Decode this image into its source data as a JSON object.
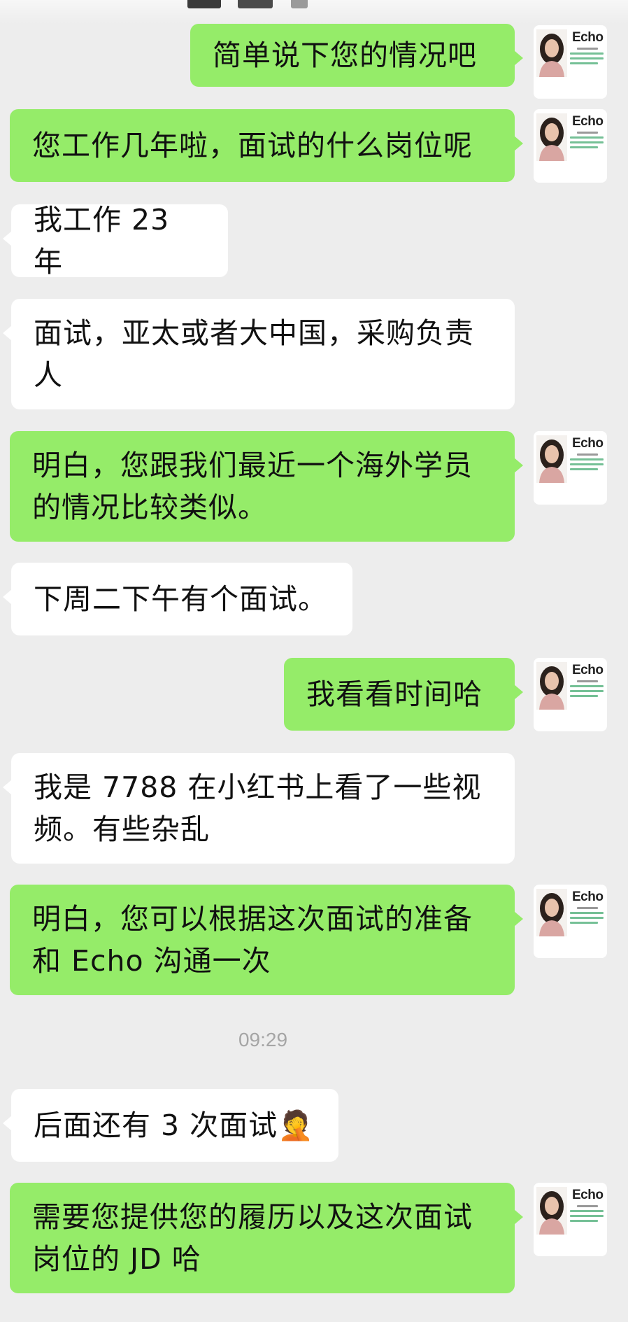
{
  "colors": {
    "background": "#ededed",
    "outgoing_bubble": "#95ec69",
    "incoming_bubble": "#ffffff",
    "timestamp_text": "#a5a5a5"
  },
  "avatar": {
    "brand_text": "Echo",
    "icon": "person-photo-with-echo-logo"
  },
  "messages": [
    {
      "direction": "outgoing",
      "text": "简单说下您的情况吧"
    },
    {
      "direction": "outgoing",
      "text": "您工作几年啦，面试的什么岗位呢"
    },
    {
      "direction": "incoming",
      "text": "我工作 23 年"
    },
    {
      "direction": "incoming",
      "text": "面试，亚太或者大中国，采购负责人"
    },
    {
      "direction": "outgoing",
      "text": "明白，您跟我们最近一个海外学员的情况比较类似。"
    },
    {
      "direction": "incoming",
      "text": "下周二下午有个面试。"
    },
    {
      "direction": "outgoing",
      "text": "我看看时间哈"
    },
    {
      "direction": "incoming",
      "text": "我是 7788 在小红书上看了一些视频。有些杂乱"
    },
    {
      "direction": "outgoing",
      "text": "明白，您可以根据这次面试的准备和 Echo 沟通一次"
    },
    {
      "direction": "incoming",
      "text": "后面还有 3 次面试",
      "emoji": "🤦"
    },
    {
      "direction": "outgoing",
      "text": "需要您提供您的履历以及这次面试岗位的 JD 哈"
    }
  ],
  "timestamp": "09:29"
}
